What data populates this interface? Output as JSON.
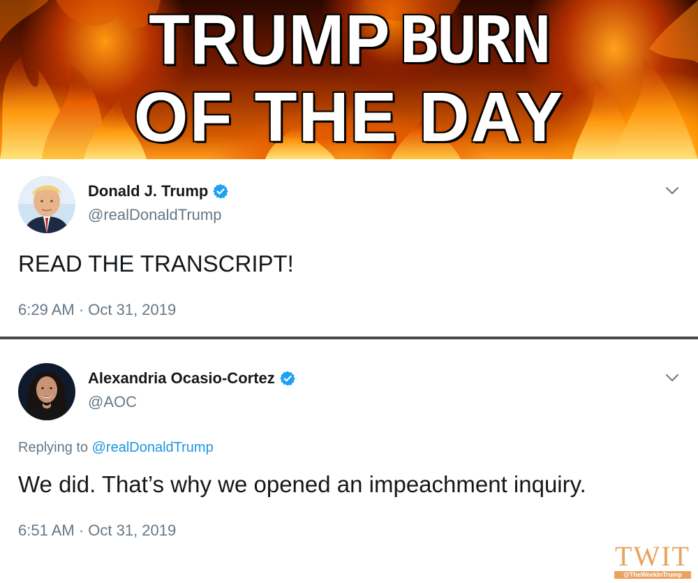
{
  "banner": {
    "line1_word1": "TRUMP",
    "line1_word2": "BURN",
    "line2": "OF THE DAY"
  },
  "tweets": [
    {
      "display_name": "Donald J. Trump",
      "handle": "@realDonaldTrump",
      "verified": true,
      "text": "READ THE TRANSCRIPT!",
      "timestamp": "6:29 AM · Oct 31, 2019"
    },
    {
      "display_name": "Alexandria Ocasio-Cortez",
      "handle": "@AOC",
      "verified": true,
      "reply_prefix": "Replying to ",
      "reply_to": "@realDonaldTrump",
      "text": "We did. That’s why we opened an impeachment inquiry.",
      "timestamp": "6:51 AM · Oct 31, 2019"
    }
  ],
  "watermark": {
    "logo": "TWIT",
    "tagline": "@TheWeekInTrump"
  },
  "colors": {
    "verified_blue": "#1da1f2",
    "secondary_text": "#657786",
    "link_blue": "#1b95e0",
    "watermark_orange": "#e8a35c"
  },
  "icons": [
    "verified-badge-icon",
    "chevron-down-icon",
    "flame-background"
  ]
}
